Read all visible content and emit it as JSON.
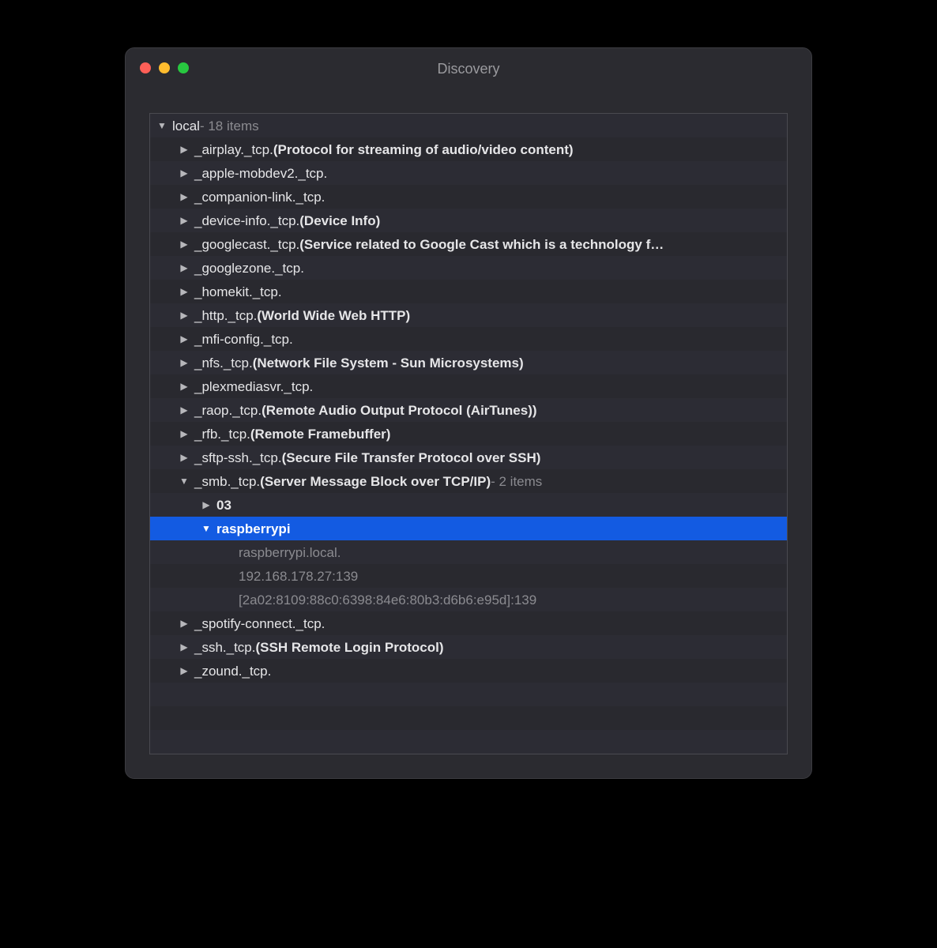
{
  "window": {
    "title": "Discovery"
  },
  "tree": {
    "root": {
      "name": "local",
      "count_suffix": " - 18 items",
      "expanded": true
    },
    "services": [
      {
        "name": "_airplay._tcp.",
        "desc": "(Protocol for streaming of audio/video content)",
        "expanded": false
      },
      {
        "name": "_apple-mobdev2._tcp.",
        "desc": "",
        "expanded": false
      },
      {
        "name": "_companion-link._tcp.",
        "desc": "",
        "expanded": false
      },
      {
        "name": "_device-info._tcp.",
        "desc": "(Device Info)",
        "expanded": false
      },
      {
        "name": "_googlecast._tcp.",
        "desc": "(Service related to Google Cast which is a technology f…",
        "expanded": false
      },
      {
        "name": "_googlezone._tcp.",
        "desc": "",
        "expanded": false
      },
      {
        "name": "_homekit._tcp.",
        "desc": "",
        "expanded": false
      },
      {
        "name": "_http._tcp.",
        "desc": "(World Wide Web HTTP)",
        "expanded": false
      },
      {
        "name": "_mfi-config._tcp.",
        "desc": "",
        "expanded": false
      },
      {
        "name": "_nfs._tcp.",
        "desc": "(Network File System - Sun Microsystems)",
        "expanded": false
      },
      {
        "name": "_plexmediasvr._tcp.",
        "desc": "",
        "expanded": false
      },
      {
        "name": "_raop._tcp.",
        "desc": "(Remote Audio Output Protocol (AirTunes))",
        "expanded": false
      },
      {
        "name": "_rfb._tcp.",
        "desc": "(Remote Framebuffer)",
        "expanded": false
      },
      {
        "name": "_sftp-ssh._tcp.",
        "desc": "(Secure File Transfer Protocol over SSH)",
        "expanded": false
      },
      {
        "name": "_smb._tcp.",
        "desc": "(Server Message Block over TCP/IP)",
        "count_suffix": " - 2 items",
        "expanded": true,
        "children": [
          {
            "name": "03",
            "expanded": false
          },
          {
            "name": "raspberrypi",
            "expanded": true,
            "selected": true,
            "details": [
              "raspberrypi.local.",
              "192.168.178.27:139",
              "[2a02:8109:88c0:6398:84e6:80b3:d6b6:e95d]:139"
            ]
          }
        ]
      },
      {
        "name": "_spotify-connect._tcp.",
        "desc": "",
        "expanded": false
      },
      {
        "name": "_ssh._tcp.",
        "desc": "(SSH Remote Login Protocol)",
        "expanded": false
      },
      {
        "name": "_zound._tcp.",
        "desc": "",
        "expanded": false
      }
    ]
  }
}
